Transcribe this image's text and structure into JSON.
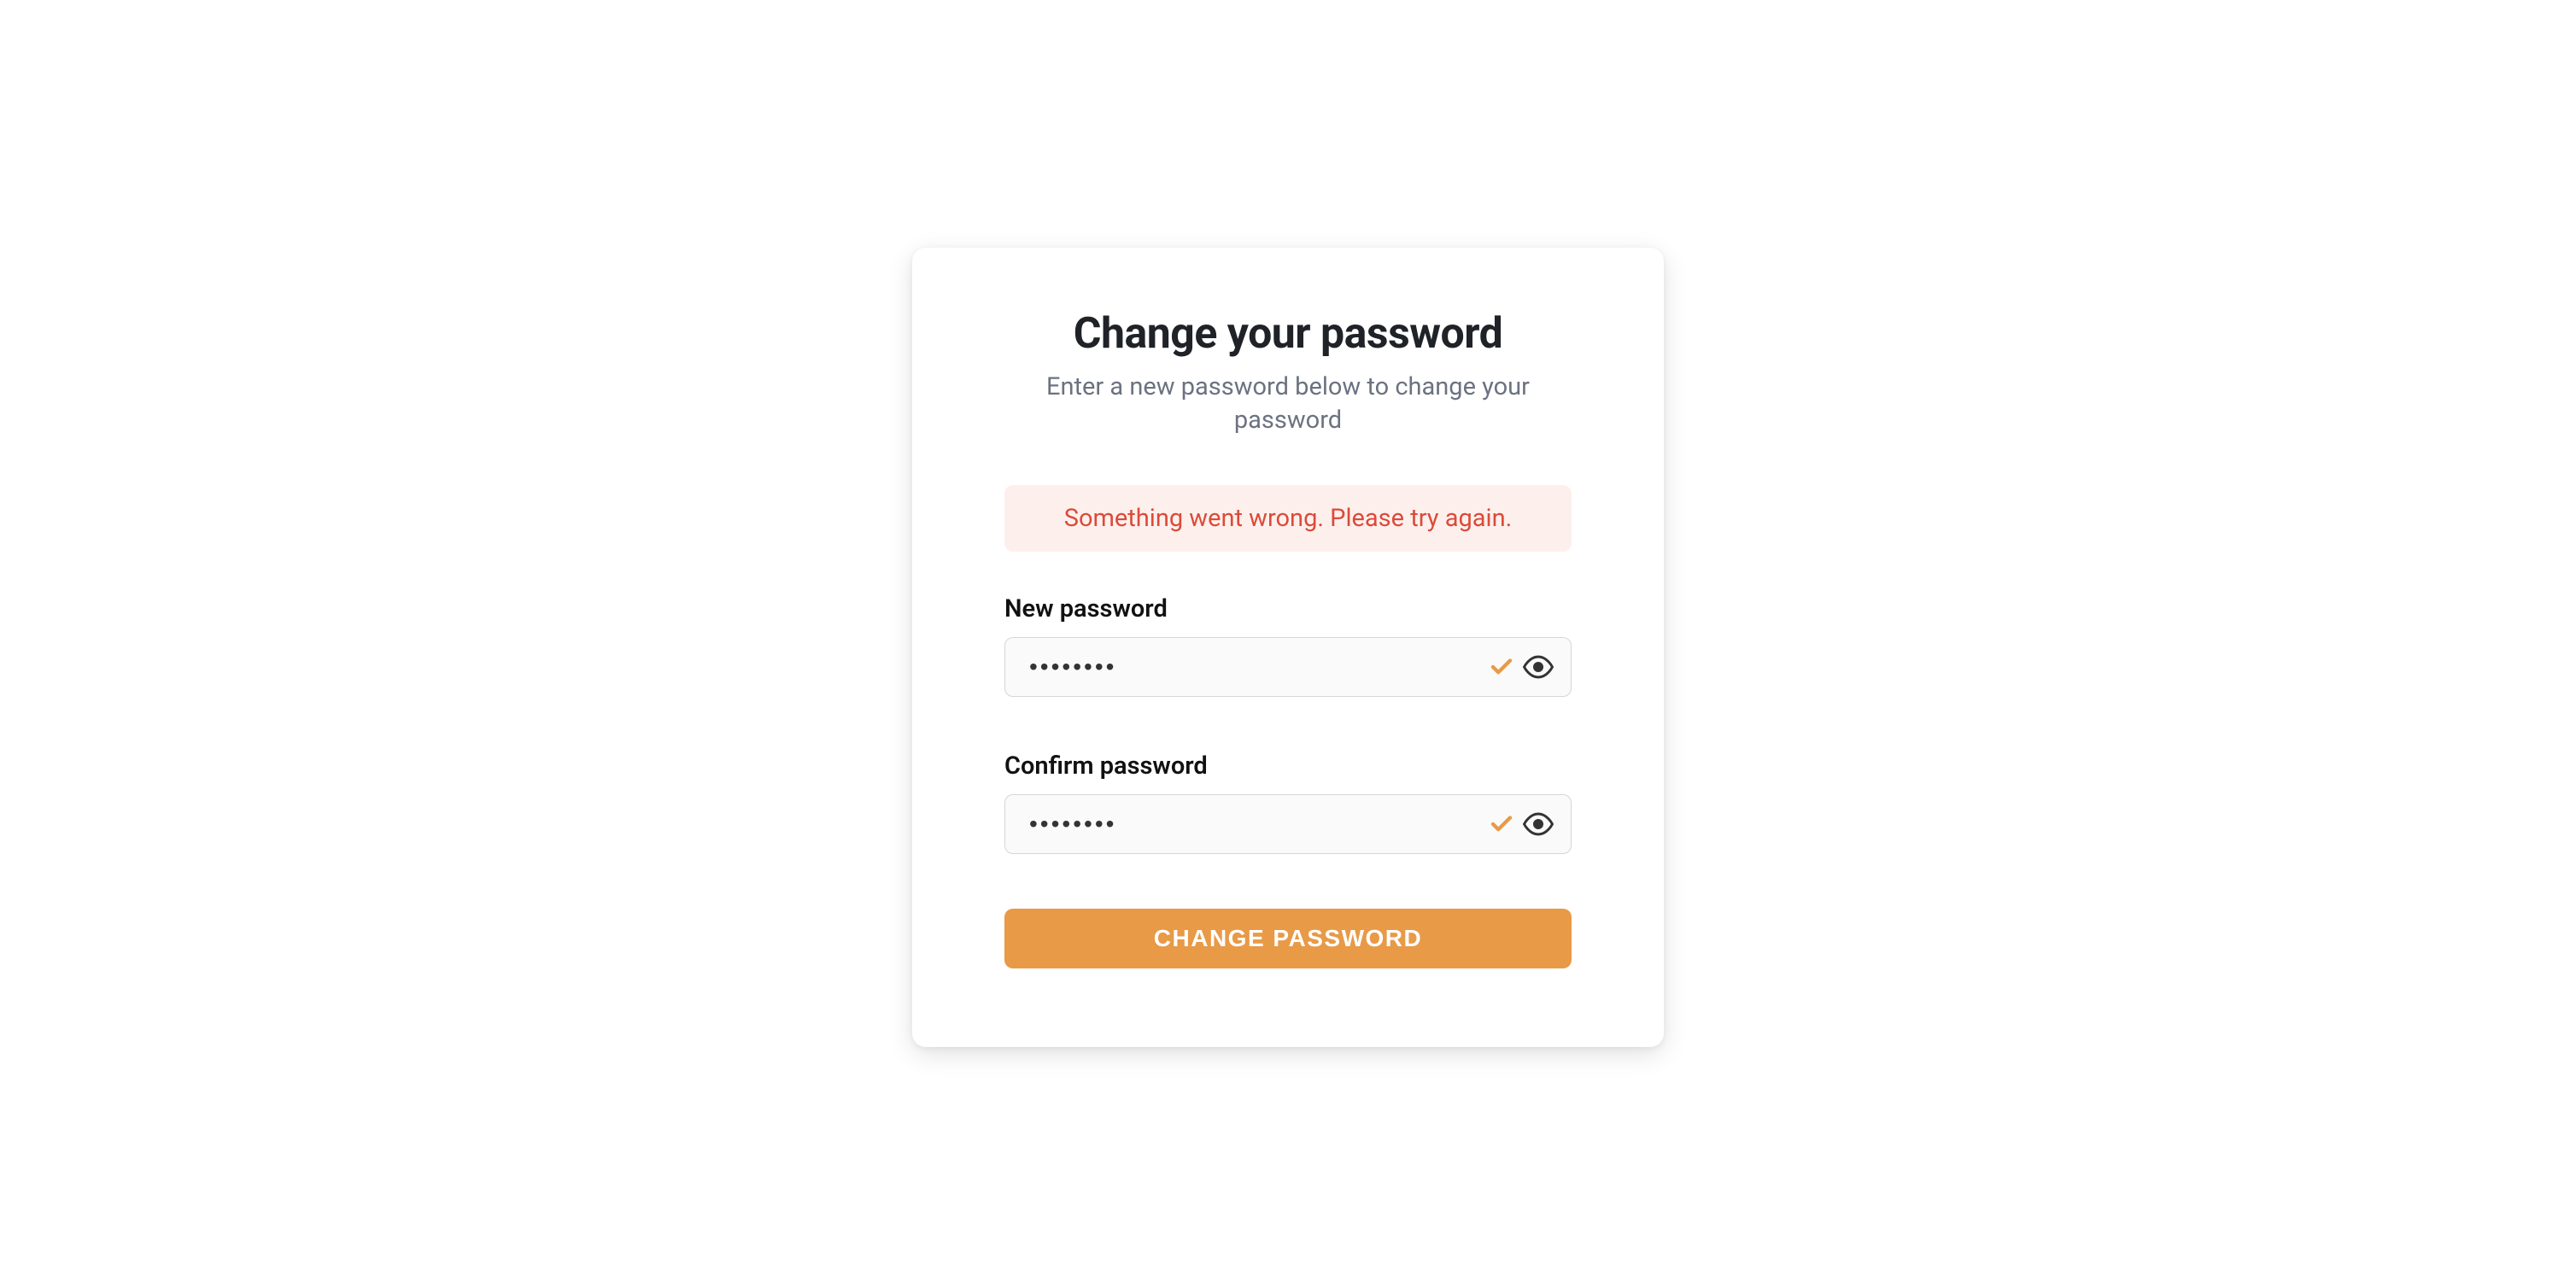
{
  "header": {
    "title": "Change your password",
    "subtitle": "Enter a new password below to change your password"
  },
  "error": {
    "message": "Something went wrong. Please try again."
  },
  "fields": {
    "new_password": {
      "label": "New password",
      "value": "••••••••"
    },
    "confirm_password": {
      "label": "Confirm password",
      "value": "••••••••"
    }
  },
  "button": {
    "submit_label": "CHANGE PASSWORD"
  },
  "colors": {
    "accent": "#e89a47",
    "error_text": "#dc4a3a",
    "error_bg": "#fdf0ec"
  }
}
